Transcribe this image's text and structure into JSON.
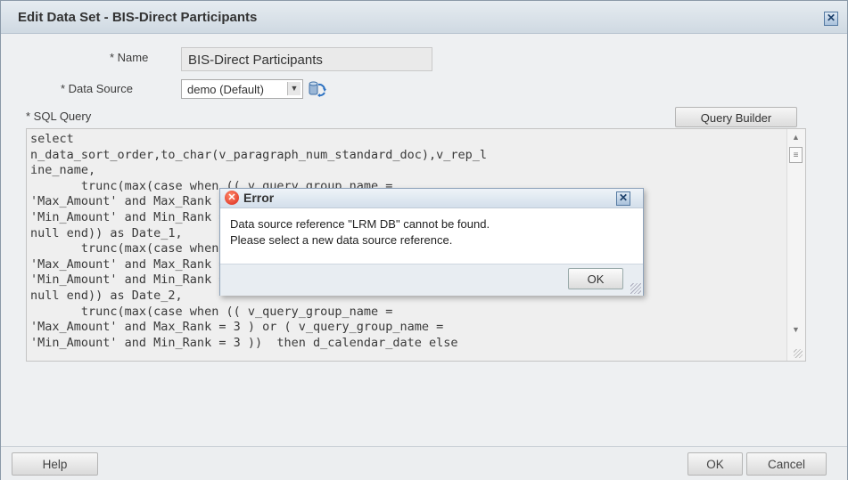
{
  "dialog": {
    "title": "Edit Data Set - BIS-Direct Participants",
    "close_icon": "close-icon"
  },
  "form": {
    "name_label": "* Name",
    "name_value": "BIS-Direct Participants",
    "data_source_label": "* Data Source",
    "data_source_value": "demo (Default)",
    "sql_label": "* SQL Query",
    "query_builder_label": "Query Builder",
    "sql_lines": [
      "select",
      "n_data_sort_order,to_char(v_paragraph_num_standard_doc),v_rep_l",
      "ine_name,",
      "       trunc(max(case when (( v_query_group_name =",
      "'Max_Amount' and Max_Rank = 1 ) or ( v_query_group_name =",
      "'Min_Amount' and Min_Rank = 1 ))  then d_calendar_date else",
      "null end)) as Date_1,",
      "       trunc(max(case when (( v_query_group_name =",
      "'Max_Amount' and Max_Rank = 2 ) or ( v_query_group_name =",
      "'Min_Amount' and Min_Rank = 2 ))  then d_calendar_date else",
      "null end)) as Date_2,",
      "       trunc(max(case when (( v_query_group_name =",
      "'Max_Amount' and Max_Rank = 3 ) or ( v_query_group_name =",
      "'Min_Amount' and Min_Rank = 3 ))  then d_calendar_date else"
    ]
  },
  "footer": {
    "help_label": "Help",
    "ok_label": "OK",
    "cancel_label": "Cancel"
  },
  "error_popup": {
    "title": "Error",
    "message_line1": "Data source reference \"LRM DB\" cannot be found.",
    "message_line2": "Please select a new data source reference.",
    "ok_label": "OK"
  },
  "colors": {
    "title_bar": "#cfd9e2",
    "error_icon": "#d9251a",
    "dialog_bg": "#eaeef1"
  }
}
